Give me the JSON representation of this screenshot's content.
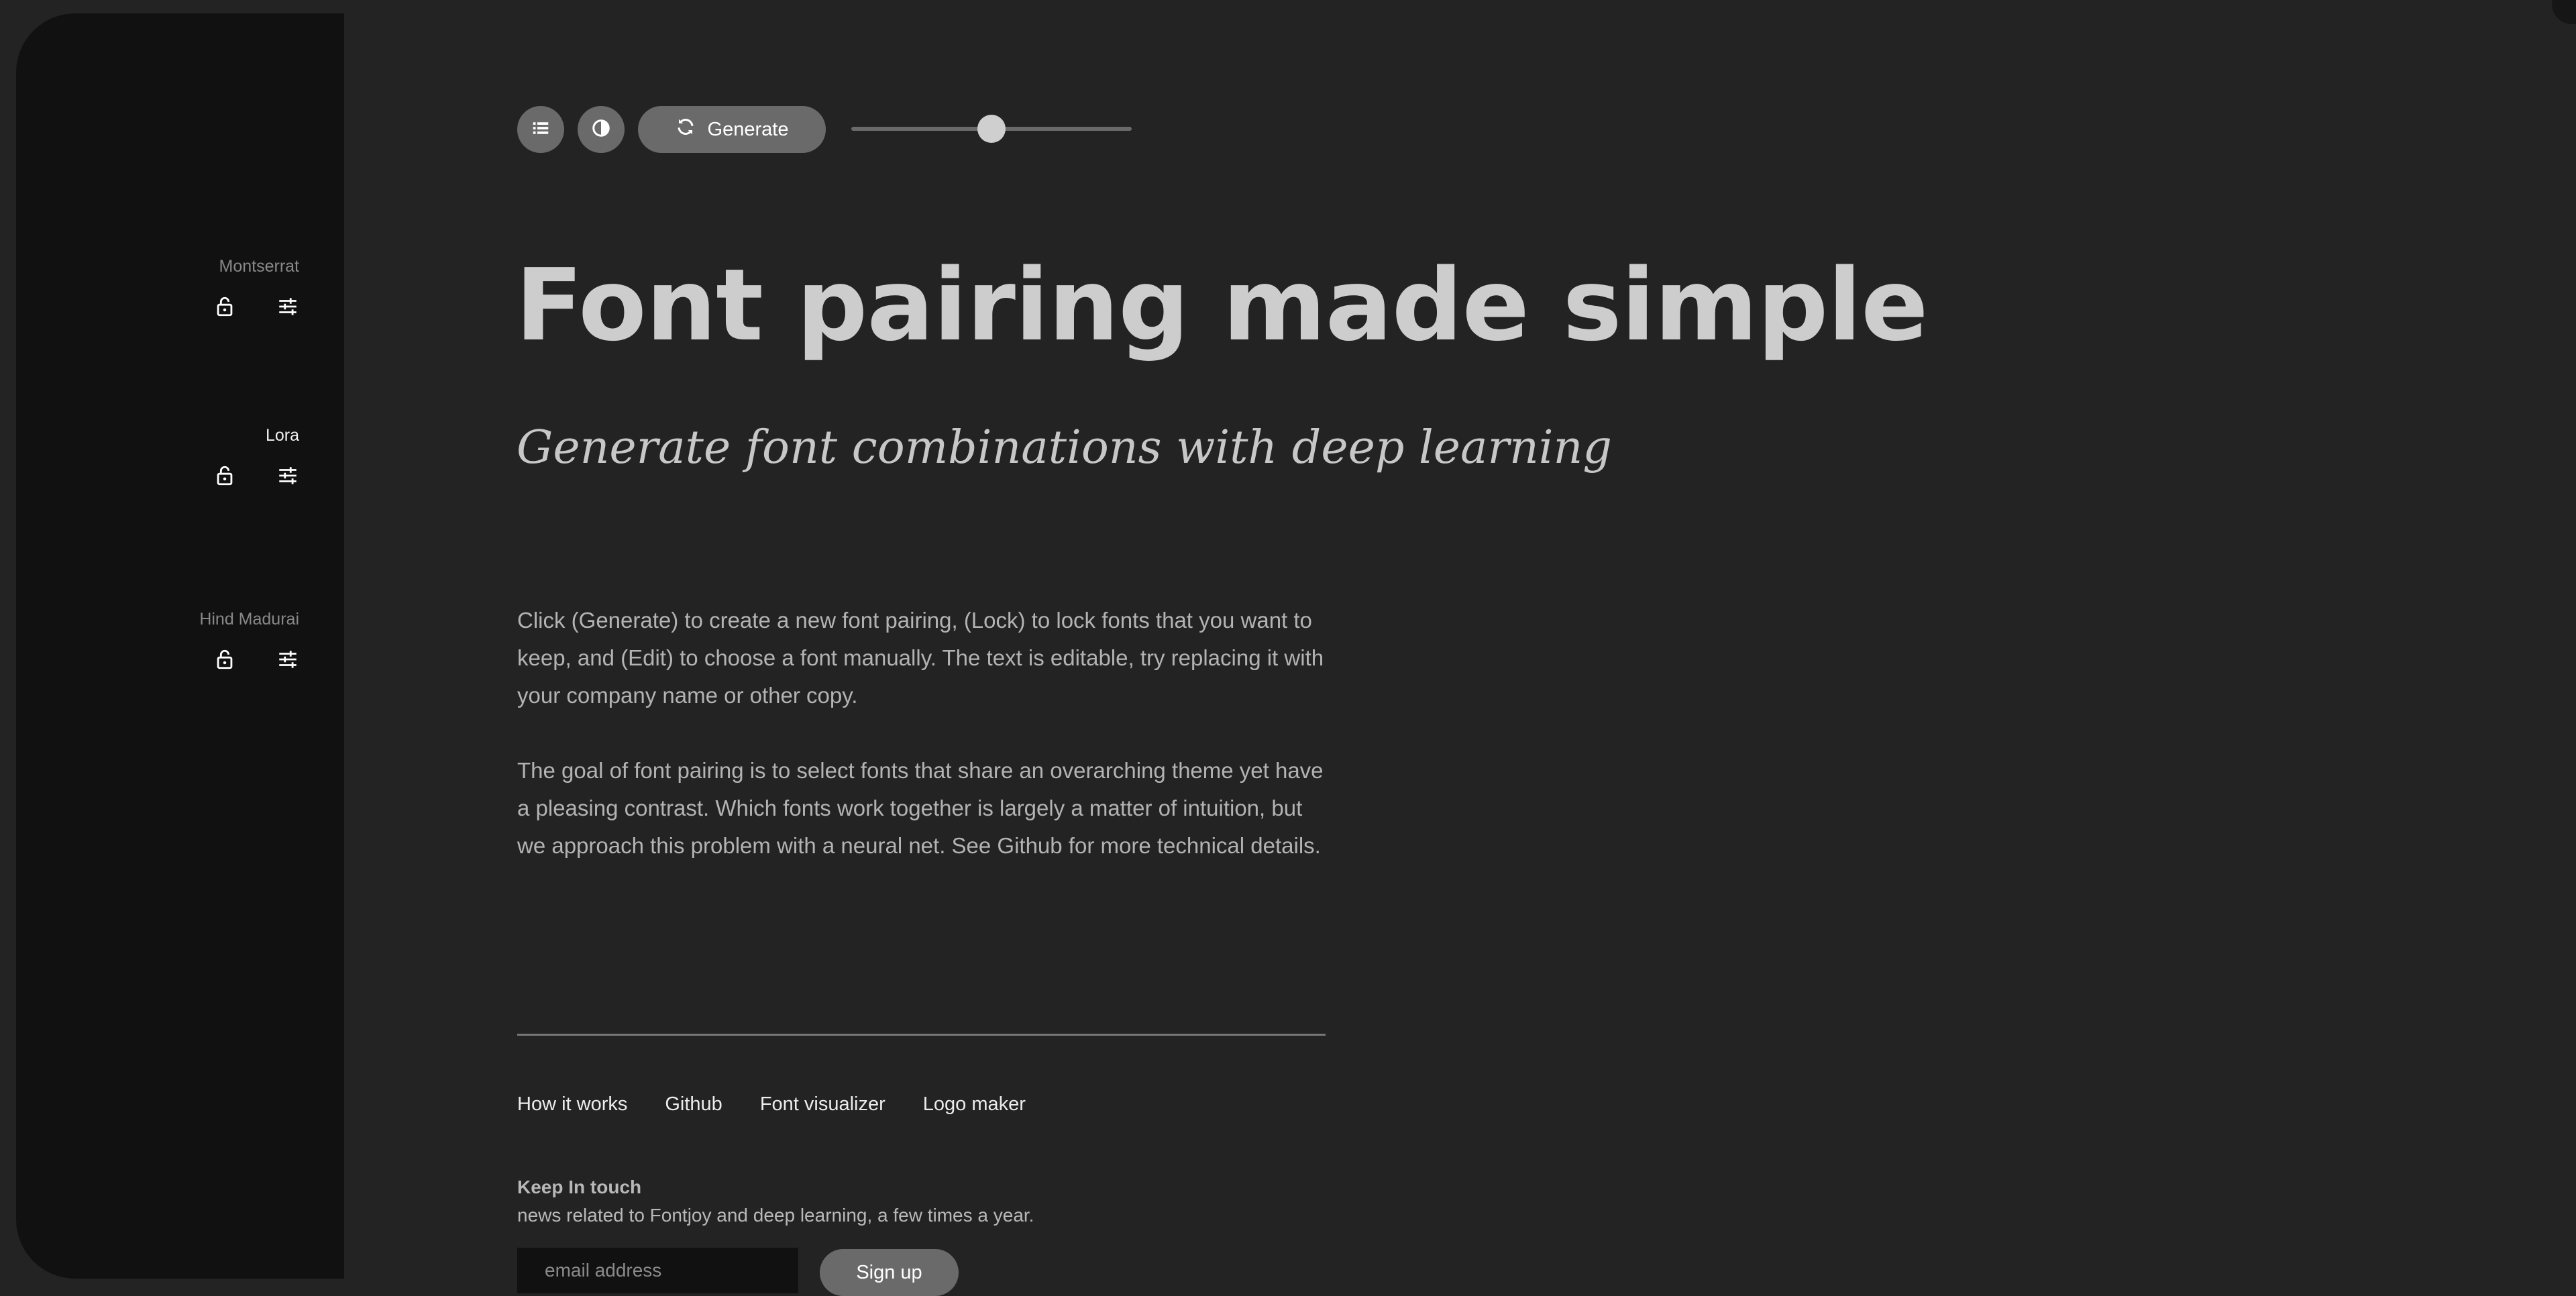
{
  "sidebar": {
    "fonts": [
      {
        "name": "Montserrat",
        "active": false
      },
      {
        "name": "Lora",
        "active": true
      },
      {
        "name": "Hind Madurai",
        "active": false
      }
    ],
    "lock_icon": "lock-icon",
    "edit_icon": "sliders-icon"
  },
  "toolbar": {
    "list_icon": "list-icon",
    "contrast_icon": "contrast-icon",
    "generate_label": "Generate",
    "generate_icon": "refresh-icon",
    "slider_value": 0.5
  },
  "main": {
    "headline": "Font pairing made simple",
    "subheadline": "Generate font combinations with deep learning",
    "paragraph_1": "Click (Generate) to create a new font pairing, (Lock) to lock fonts that you want to keep, and (Edit) to choose a font manually. The text is editable, try replacing it with your company name or other copy.",
    "paragraph_2": "The goal of font pairing is to select fonts that share an overarching theme yet have a pleasing contrast. Which fonts work together is largely a matter of intuition, but we approach this problem with a neural net. See Github for more technical details."
  },
  "footer": {
    "links": [
      "How it works",
      "Github",
      "Font visualizer",
      "Logo maker"
    ],
    "keep_title": "Keep In touch",
    "keep_desc": "news related to Fontjoy and deep learning, a few times a year.",
    "email_placeholder": "email address",
    "signup_label": "Sign up"
  },
  "colors": {
    "background": "#232323",
    "sidebar": "#111111",
    "button": "#6a6a6a",
    "headline": "#cdcdcd"
  }
}
